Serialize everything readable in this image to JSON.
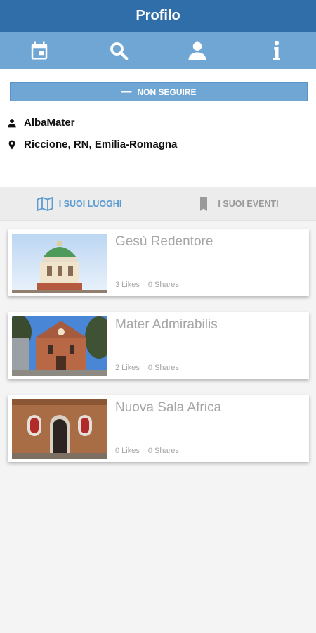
{
  "header": {
    "title": "Profilo"
  },
  "toolbar": {
    "items": [
      "calendar-icon",
      "search-icon",
      "user-icon",
      "info-icon"
    ]
  },
  "profile": {
    "follow_label": "NON SEGUIRE",
    "username": "AlbaMater",
    "location": "Riccione, RN, Emilia-Romagna"
  },
  "tabs": [
    {
      "label": "I SUOI LUOGHI",
      "icon": "map-icon",
      "active": true
    },
    {
      "label": "I SUOI EVENTI",
      "icon": "bookmark-icon",
      "active": false
    }
  ],
  "places": [
    {
      "title": "Gesù Redentore",
      "likes": "3 Likes",
      "shares": "0 Shares"
    },
    {
      "title": "Mater Admirabilis",
      "likes": "2 Likes",
      "shares": "0 Shares"
    },
    {
      "title": "Nuova Sala Africa",
      "likes": "0 Likes",
      "shares": "0 Shares"
    }
  ],
  "colors": {
    "header": "#2f6ea8",
    "toolbar": "#6fa6d4",
    "accent": "#5b9bd1"
  }
}
